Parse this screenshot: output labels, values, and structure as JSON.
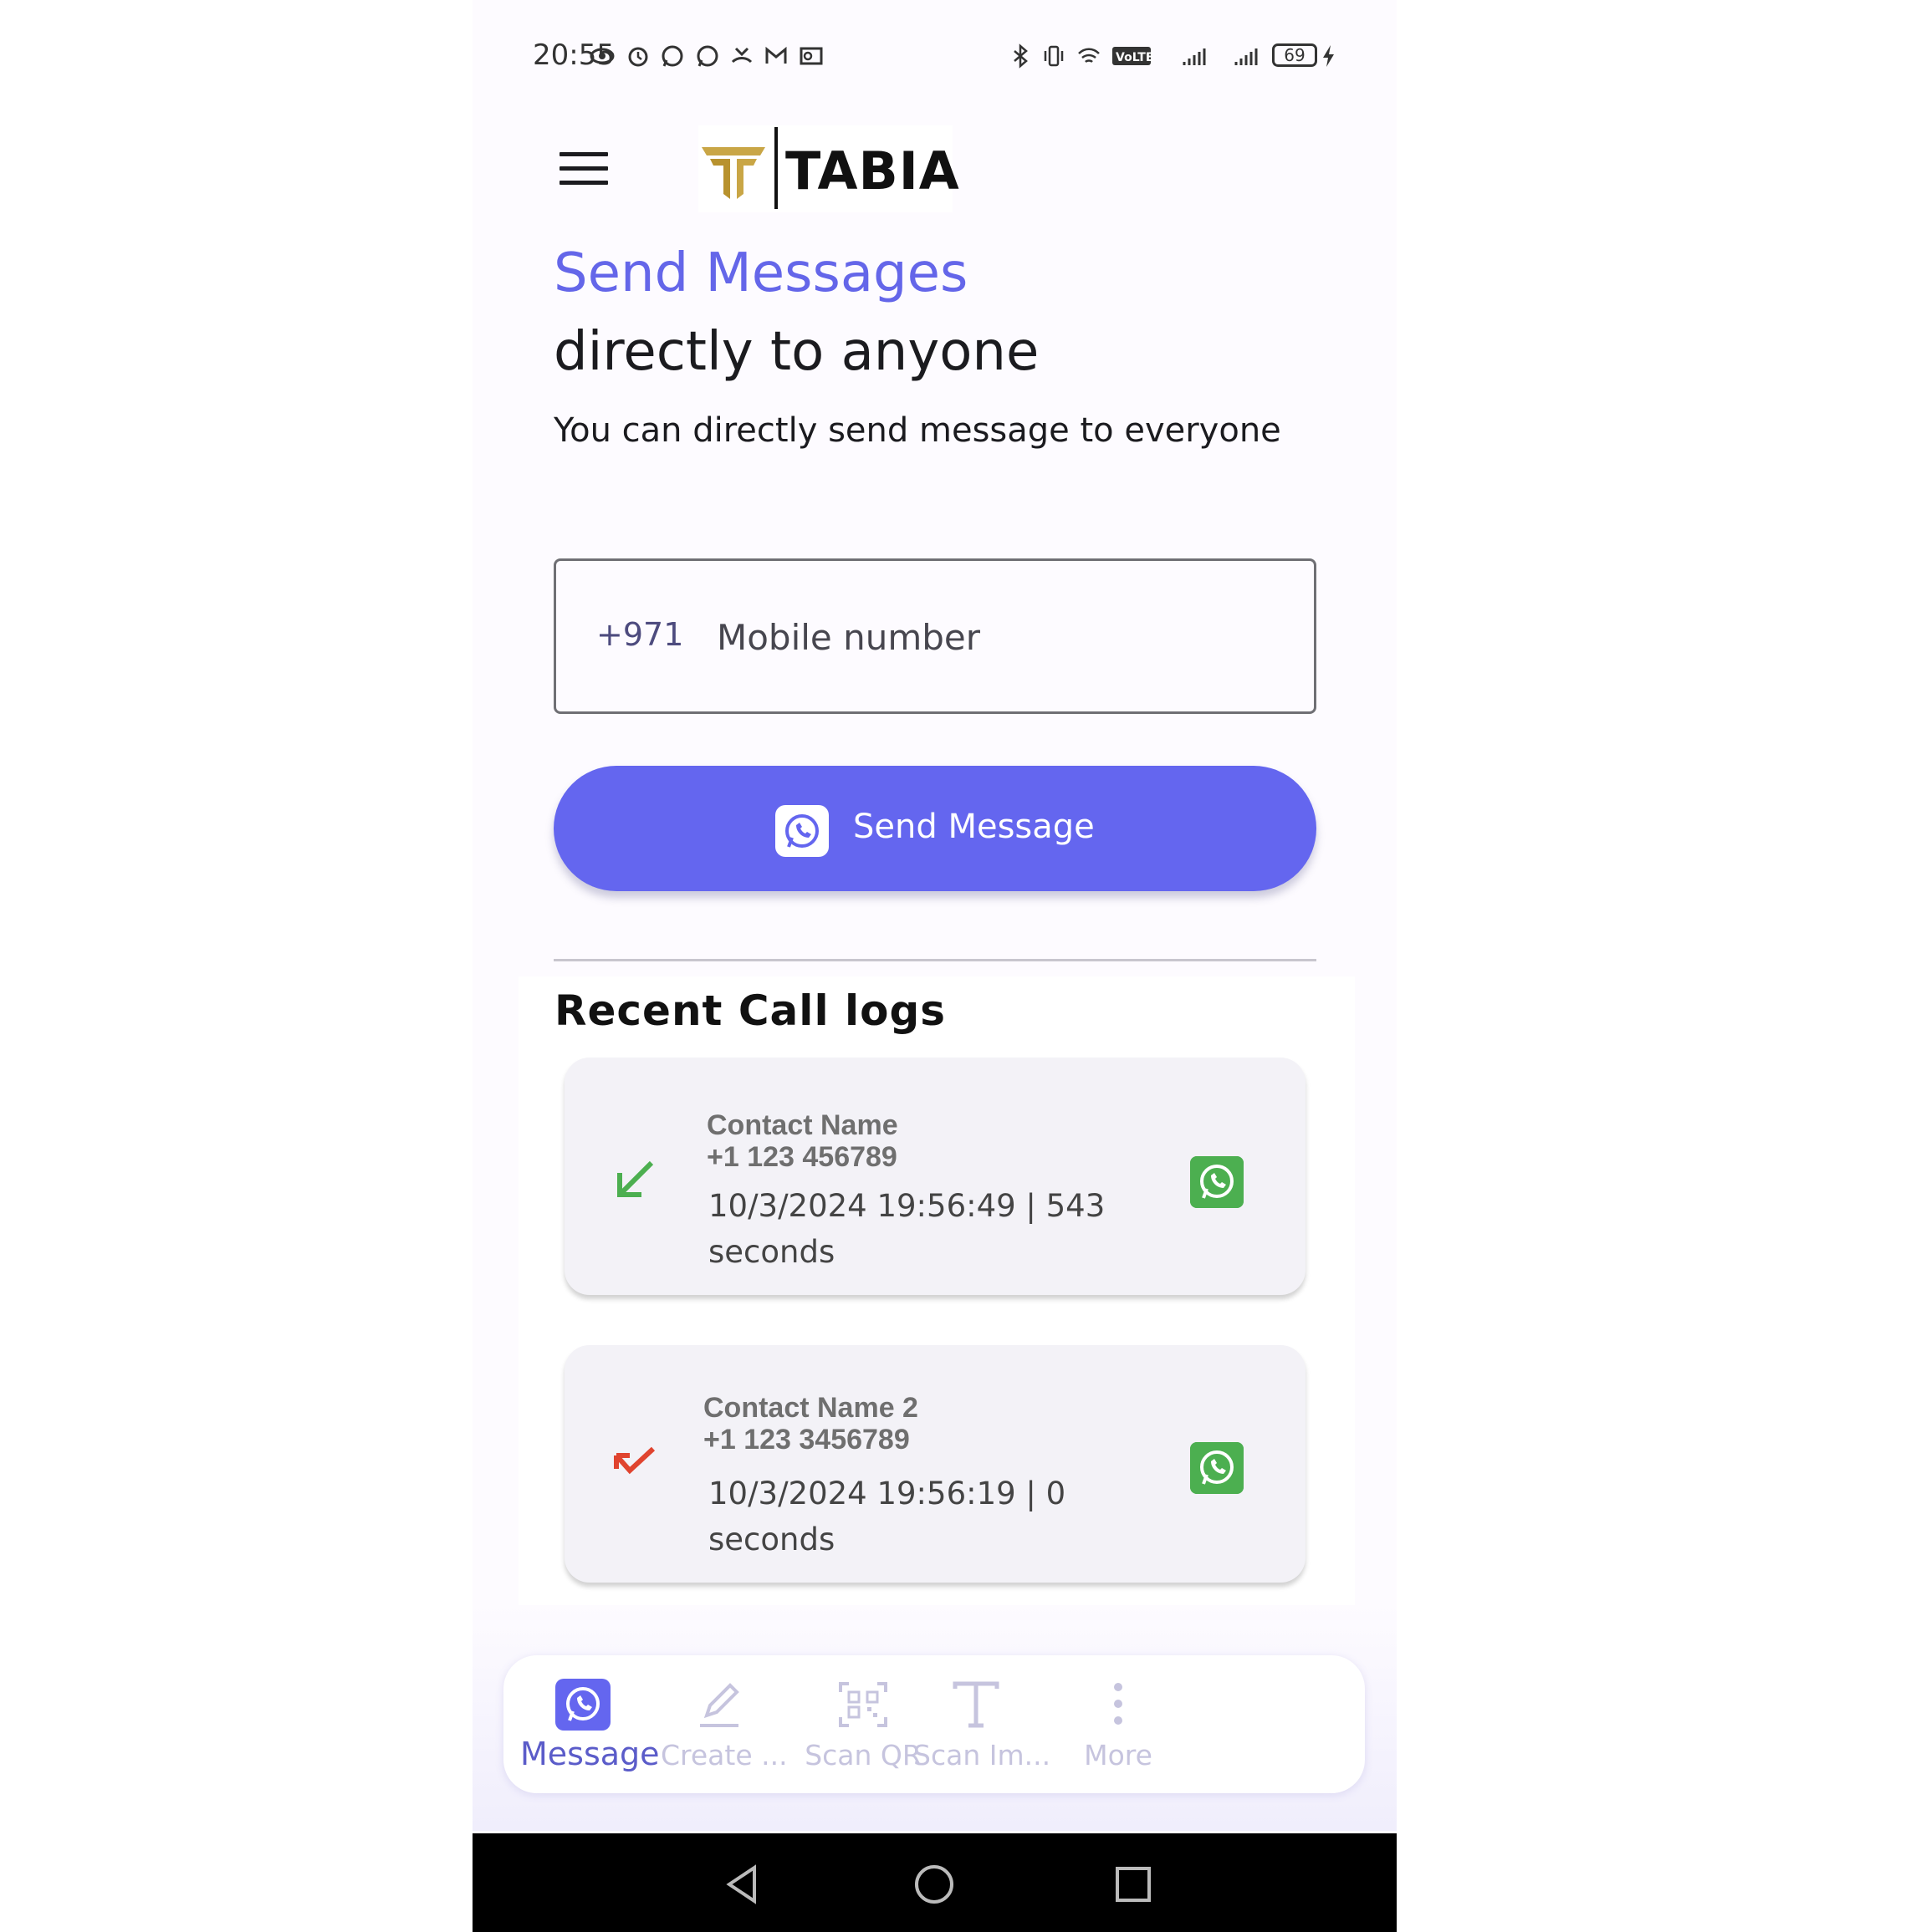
{
  "status_bar": {
    "time": "20:55",
    "battery": "69",
    "left_icons": [
      "eye-icon",
      "alarm-icon",
      "whatsapp-notification-icon",
      "whatsapp-notification-icon",
      "missed-call-icon",
      "gmail-icon",
      "outlook-icon"
    ],
    "right_icons": [
      "bluetooth-icon",
      "vibrate-icon",
      "wifi-icon",
      "volte-icon",
      "signal-icon",
      "signal-icon",
      "battery-icon",
      "charging-icon"
    ]
  },
  "header": {
    "logo_text": "TABIA"
  },
  "hero": {
    "title": "Send Messages",
    "subtitle": "directly to anyone",
    "description": "You can directly send message to everyone"
  },
  "phone_input": {
    "country_code": "+971",
    "placeholder": "Mobile number",
    "value": ""
  },
  "send_button": {
    "label": "Send Message"
  },
  "call_logs": {
    "title": "Recent Call logs",
    "items": [
      {
        "name": "Contact Name",
        "number": "+1 123 456789",
        "meta": "10/3/2024 19:56:49 | 543 seconds",
        "direction": "incoming",
        "color": "#4caf50"
      },
      {
        "name": "Contact Name 2",
        "number": "+1 123 3456789",
        "meta": "10/3/2024 19:56:19 | 0 seconds",
        "direction": "missed",
        "color": "#e0442f"
      }
    ]
  },
  "bottom_nav": {
    "items": [
      {
        "label": "Message",
        "icon": "whatsapp-icon",
        "active": true
      },
      {
        "label": "Create ...",
        "icon": "pencil-icon",
        "active": false
      },
      {
        "label": "Scan QR",
        "icon": "qr-code-icon",
        "active": false
      },
      {
        "label": "Scan Im...",
        "icon": "text-icon",
        "active": false
      },
      {
        "label": "More",
        "icon": "more-vertical-icon",
        "active": false
      }
    ]
  },
  "colors": {
    "accent": "#6466ef",
    "title_accent": "#6466e9",
    "whatsapp_green": "#4caf50",
    "missed_red": "#e0442f",
    "nav_inactive": "#c6c4de",
    "logo_gold": "#c9a646"
  }
}
